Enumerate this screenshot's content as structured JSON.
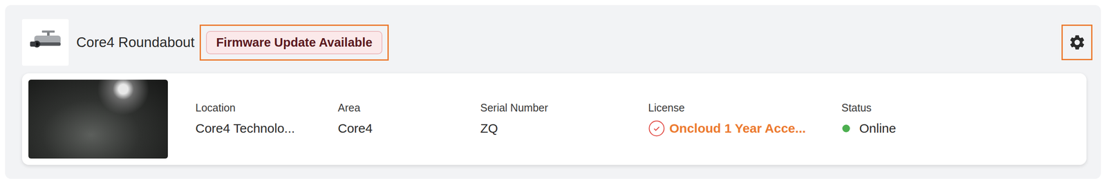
{
  "device": {
    "name": "Core4 Roundabout",
    "badge": {
      "label": "Firmware Update Available",
      "highlighted": true
    },
    "settings": {
      "highlighted": true
    }
  },
  "fields": [
    {
      "kind": "text",
      "label": "Location",
      "value": "Core4 Technolo..."
    },
    {
      "kind": "text",
      "label": "Area",
      "value": "Core4"
    },
    {
      "kind": "text",
      "label": "Serial Number",
      "value": "ZQ"
    },
    {
      "kind": "license",
      "label": "License",
      "value": "Oncloud 1 Year Acce..."
    },
    {
      "kind": "status",
      "label": "Status",
      "value": "Online",
      "color": "#4caf50"
    }
  ]
}
